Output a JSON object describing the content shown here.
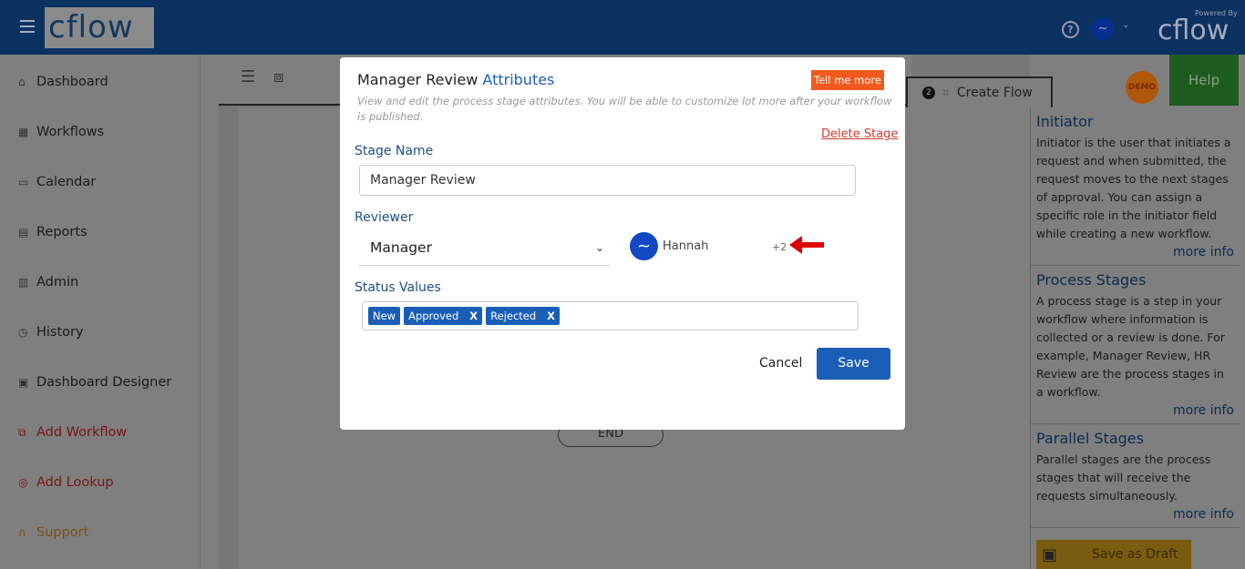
{
  "header": {
    "logo": "cflow",
    "powered_by": "Powered By",
    "powered_logo": "cflow",
    "help_icon": "question-circle-icon"
  },
  "sidebar": {
    "items": [
      {
        "label": "Dashboard",
        "icon": "home-icon"
      },
      {
        "label": "Workflows",
        "icon": "grid-icon"
      },
      {
        "label": "Calendar",
        "icon": "calendar-icon"
      },
      {
        "label": "Reports",
        "icon": "report-icon"
      },
      {
        "label": "Admin",
        "icon": "book-icon"
      },
      {
        "label": "History",
        "icon": "history-icon"
      },
      {
        "label": "Dashboard Designer",
        "icon": "designer-icon"
      },
      {
        "label": "Add Workflow",
        "icon": "sitemap-icon"
      },
      {
        "label": "Add Lookup",
        "icon": "target-icon"
      },
      {
        "label": "Support",
        "icon": "headset-icon"
      }
    ]
  },
  "toolbar": {
    "create_flow_step": "2",
    "create_flow_label": "Create Flow",
    "demo": "DEMO",
    "help": "Help"
  },
  "canvas": {
    "end_node": "END"
  },
  "right_panel": {
    "sections": [
      {
        "title": "Initiator",
        "text": "Initiator is the user that initiates a request and when submitted, the request moves to the next stages of approval. You can assign a specific role in the initiator field while creating a new workflow.",
        "more": "more info"
      },
      {
        "title": "Process Stages",
        "text": "A process stage is a step in your workflow where information is collected or a review is done. For example, Manager Review, HR Review are the process stages in a workflow.",
        "more": "more info"
      },
      {
        "title": "Parallel Stages",
        "text": "Parallel stages are the process stages that will receive the requests simultaneously.",
        "more": "more info"
      }
    ],
    "save_draft": "Save as Draft"
  },
  "modal": {
    "title": "Manager Review",
    "title_suffix": "Attributes",
    "tell_more": "Tell me more",
    "description": "View and edit the process stage attributes. You will be able to customize lot more after your workflow is published.",
    "delete_stage": "Delete Stage",
    "stage_name_label": "Stage Name",
    "stage_name_value": "Manager Review",
    "reviewer_label": "Reviewer",
    "reviewer_value": "Manager",
    "reviewer_user": "Hannah",
    "reviewer_more": "+2",
    "status_label": "Status Values",
    "status_values": [
      {
        "label": "New",
        "removable": false
      },
      {
        "label": "Approved",
        "removable": true,
        "remove": "X"
      },
      {
        "label": "Rejected",
        "removable": true,
        "remove": "X"
      }
    ],
    "cancel": "Cancel",
    "save": "Save"
  },
  "colors": {
    "primary": "#1a5eb8",
    "tell_more": "#f05a1e",
    "delete": "#d23a2a",
    "arrow": "#e00000"
  }
}
